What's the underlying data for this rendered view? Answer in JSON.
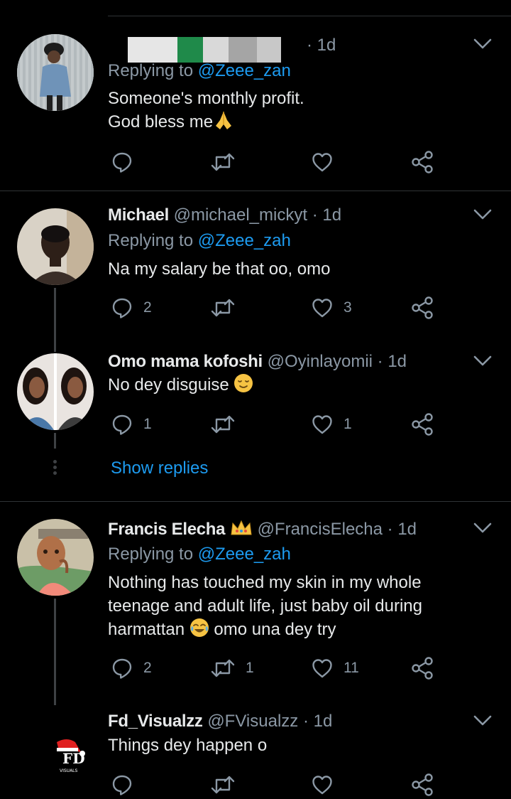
{
  "tweets": [
    {
      "name": "",
      "handle": "",
      "time": "· 1d",
      "replying_prefix": "Replying to",
      "replying_to": "@Zeee_zan",
      "text_lines": [
        "Someone's monthly profit.",
        "God bless me"
      ],
      "replies": "",
      "retweets": "",
      "likes": ""
    },
    {
      "name": "Michael",
      "handle": "@michael_mickyt",
      "time": "· 1d",
      "replying_prefix": "Replying to",
      "replying_to": "@Zeee_zah",
      "text_lines": [
        "Na my salary be that oo, omo"
      ],
      "replies": "2",
      "retweets": "",
      "likes": "3"
    },
    {
      "name": "Omo mama kofoshi",
      "handle": "@Oyinlayomii",
      "time": "· 1d",
      "text_lines": [
        "No dey disguise"
      ],
      "replies": "1",
      "retweets": "",
      "likes": "1"
    },
    {
      "name": "Francis Elecha",
      "handle": "@FrancisElecha",
      "time": "· 1d",
      "replying_prefix": "Replying to",
      "replying_to": "@Zeee_zah",
      "text_lines": [
        "Nothing has touched my skin in my whole",
        "teenage and adult life, just baby oil during",
        "harmattan",
        "omo una dey try"
      ],
      "replies": "2",
      "retweets": "1",
      "likes": "11"
    },
    {
      "name": "Fd_Visualzz",
      "handle": "@FVisualzz",
      "time": "· 1d",
      "text_lines": [
        "Things dey happen o"
      ],
      "replies": "",
      "retweets": "",
      "likes": ""
    }
  ],
  "show_replies": "Show replies",
  "icons": {
    "reply": "reply-bubble-icon",
    "retweet": "retweet-icon",
    "like": "heart-icon",
    "share": "share-icon",
    "menu": "chevron-down-icon"
  },
  "colors": {
    "background": "#000000",
    "text": "#e7e9ea",
    "secondary": "#8b98a5",
    "link": "#1d9bf0",
    "divider": "#2f3336"
  }
}
